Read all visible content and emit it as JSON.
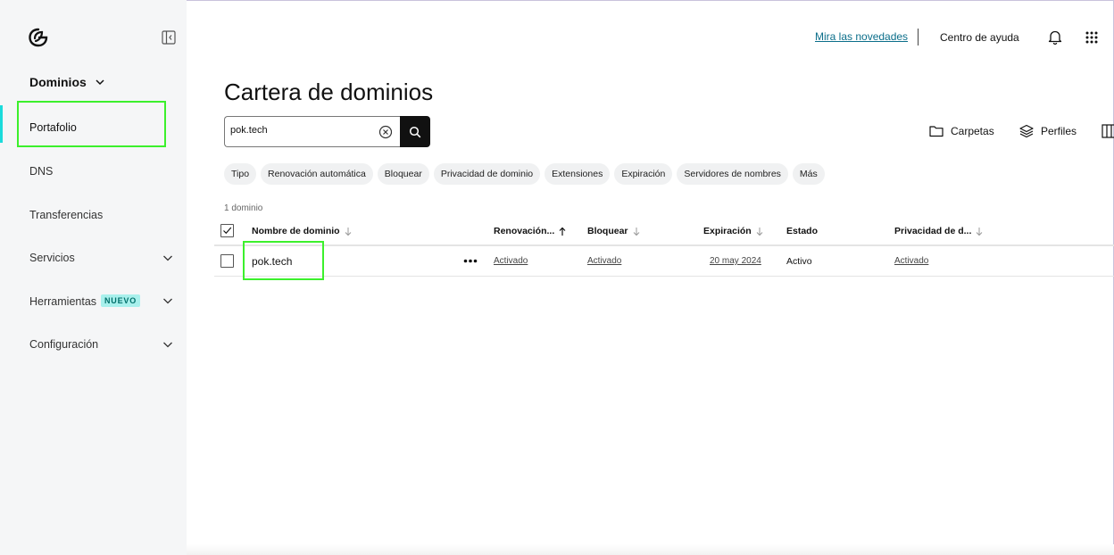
{
  "header": {
    "news_link": "Mira las novedades",
    "help_link": "Centro de ayuda"
  },
  "sidebar": {
    "section_title": "Dominios",
    "items": [
      {
        "label": "Portafolio"
      },
      {
        "label": "DNS"
      },
      {
        "label": "Transferencias"
      },
      {
        "label": "Servicios"
      },
      {
        "label": "Herramientas",
        "badge": "NUEVO"
      },
      {
        "label": "Configuración"
      }
    ]
  },
  "main": {
    "title": "Cartera de dominios",
    "search": {
      "value": "pok.tech"
    },
    "tools": {
      "folders": "Carpetas",
      "profiles": "Perfiles"
    },
    "filters": [
      "Tipo",
      "Renovación automática",
      "Bloquear",
      "Privacidad de dominio",
      "Extensiones",
      "Expiración",
      "Servidores de nombres",
      "Más"
    ],
    "count": "1 dominio",
    "table": {
      "columns": {
        "name": "Nombre de dominio",
        "renewal": "Renovación...",
        "lock": "Bloquear",
        "expiration": "Expiración",
        "status": "Estado",
        "privacy": "Privacidad de d..."
      },
      "rows": [
        {
          "name": "pok.tech",
          "renewal": "Activado",
          "lock": "Activado",
          "expiration": "20 may 2024",
          "status": "Activo",
          "privacy": "Activado"
        }
      ]
    }
  },
  "colors": {
    "accent_bar": "#1bdbdb",
    "highlight": "#3cf02c",
    "badge_bg": "#a8f0ec",
    "link": "#0b6e8a"
  }
}
